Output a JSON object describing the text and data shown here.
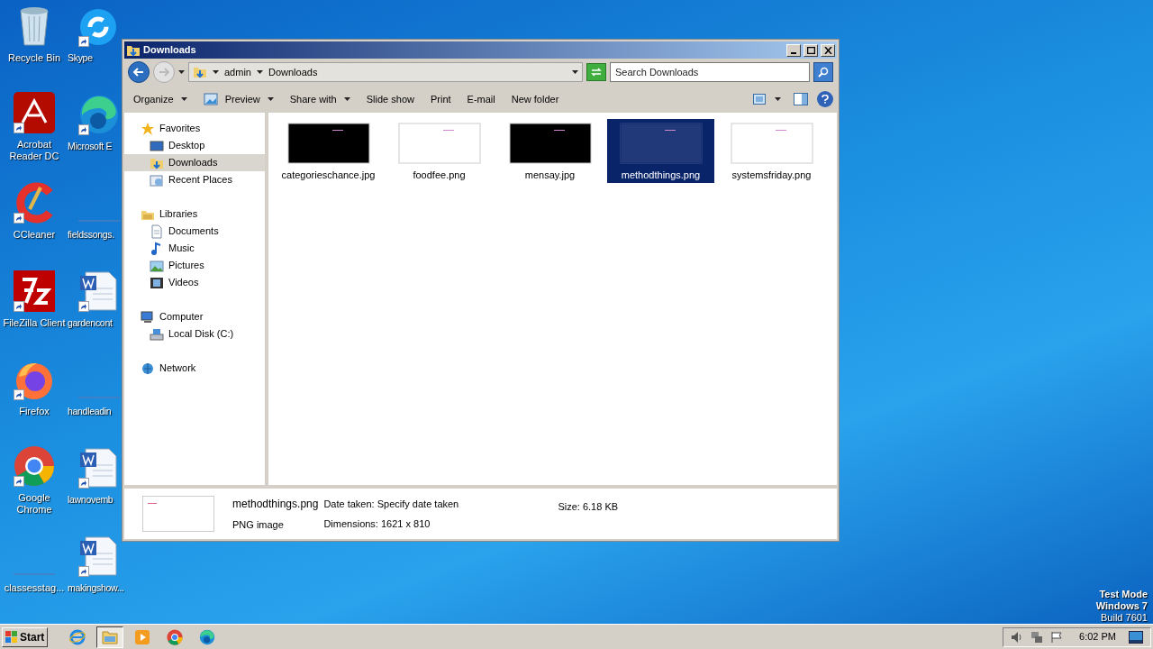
{
  "desktop_columns": [
    [
      {
        "label": "Recycle Bin",
        "kind": "recycle"
      },
      {
        "label": "Acrobat Reader DC",
        "kind": "acrobat"
      },
      {
        "label": "CCleaner",
        "kind": "ccleaner"
      },
      {
        "label": "FileZilla Client",
        "kind": "filezilla"
      },
      {
        "label": "Firefox",
        "kind": "firefox"
      },
      {
        "label": "Google Chrome",
        "kind": "chrome"
      },
      {
        "label": "classesstag...",
        "kind": "blank"
      }
    ],
    [
      {
        "label": "Skype",
        "kind": "skype"
      },
      {
        "label": "Microsoft E",
        "kind": "edge"
      },
      {
        "label": "fieldssongs.",
        "kind": "blank"
      },
      {
        "label": "gardencont",
        "kind": "word"
      },
      {
        "label": "handleadin",
        "kind": "blank"
      },
      {
        "label": "lawnovemb",
        "kind": "word"
      },
      {
        "label": "makingshow...",
        "kind": "word"
      }
    ]
  ],
  "window": {
    "title": "Downloads",
    "address": [
      "admin",
      "Downloads"
    ],
    "search": {
      "placeholder": "Search Downloads"
    },
    "toolbar": [
      {
        "label": "Organize",
        "dropdown": true
      },
      {
        "label": "Preview",
        "dropdown": true
      },
      {
        "label": "Share with",
        "dropdown": true
      },
      {
        "label": "Slide show",
        "dropdown": false
      },
      {
        "label": "Print",
        "dropdown": false
      },
      {
        "label": "E-mail",
        "dropdown": false
      },
      {
        "label": "New folder",
        "dropdown": false
      }
    ],
    "nav": [
      {
        "label": "Favorites",
        "kind": "star",
        "children": [
          {
            "label": "Desktop",
            "kind": "desktop",
            "selected": false
          },
          {
            "label": "Downloads",
            "kind": "downloads",
            "selected": true
          },
          {
            "label": "Recent Places",
            "kind": "recent",
            "selected": false
          }
        ]
      },
      {
        "label": "Libraries",
        "kind": "library",
        "children": [
          {
            "label": "Documents",
            "kind": "documents",
            "selected": false
          },
          {
            "label": "Music",
            "kind": "music",
            "selected": false
          },
          {
            "label": "Pictures",
            "kind": "pictures",
            "selected": false
          },
          {
            "label": "Videos",
            "kind": "videos",
            "selected": false
          }
        ]
      },
      {
        "label": "Computer",
        "kind": "computer",
        "children": [
          {
            "label": "Local Disk (C:)",
            "kind": "disk",
            "selected": false
          }
        ]
      },
      {
        "label": "Network",
        "kind": "network"
      }
    ],
    "files": [
      {
        "name": "categorieschance.jpg",
        "kind": "dark",
        "selected": false
      },
      {
        "name": "foodfee.png",
        "kind": "light",
        "selected": false
      },
      {
        "name": "mensay.jpg",
        "kind": "dark",
        "selected": false
      },
      {
        "name": "methodthings.png",
        "kind": "light",
        "selected": true
      },
      {
        "name": "systemsfriday.png",
        "kind": "light",
        "selected": false
      }
    ],
    "details": {
      "name": "methodthings.png",
      "type": "PNG image",
      "fields": [
        {
          "label": "Date taken:",
          "value": "Specify date taken"
        },
        {
          "label": "Dimensions:",
          "value": "1621 x 810"
        },
        {
          "label": "Size:",
          "value": "6.18 KB"
        }
      ]
    }
  },
  "os_badge": [
    "Test Mode",
    "Windows 7",
    "Build 7601"
  ],
  "taskbar": {
    "start": "Start",
    "apps": [
      {
        "kind": "ie",
        "active": false
      },
      {
        "kind": "explorer",
        "active": true
      },
      {
        "kind": "media",
        "active": false
      },
      {
        "kind": "chrome",
        "active": false
      },
      {
        "kind": "edge",
        "active": false
      }
    ],
    "clock": "6:02 PM"
  }
}
